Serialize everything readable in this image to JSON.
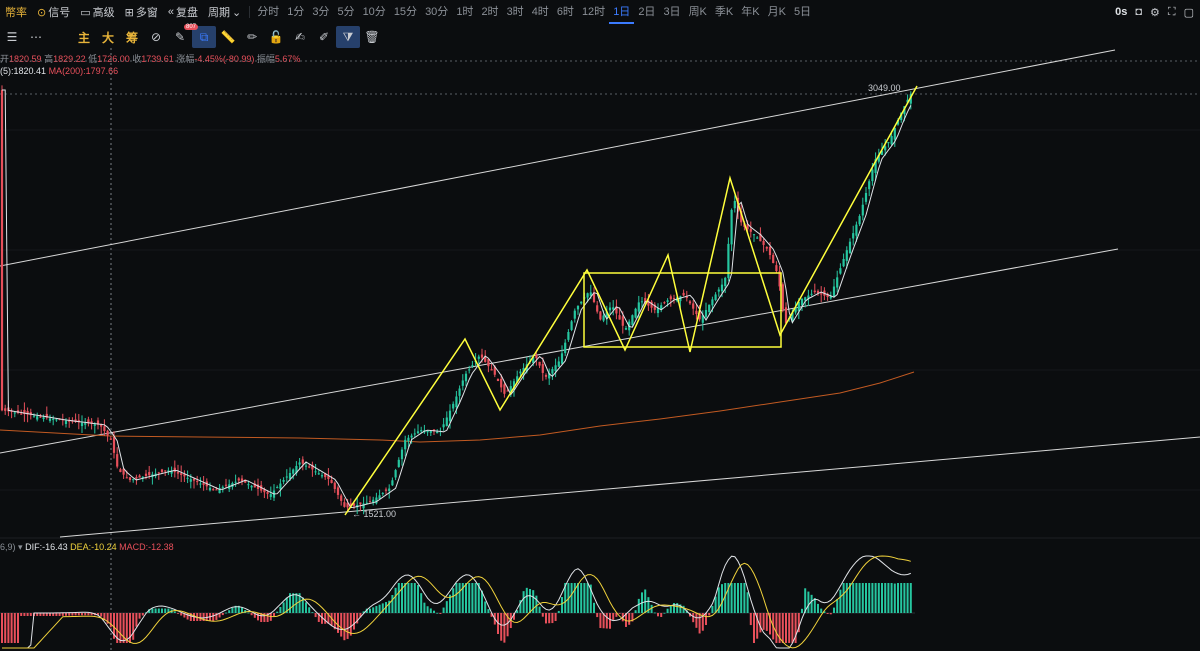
{
  "toolbar": {
    "items": [
      {
        "key": "rate",
        "label": "幣率"
      },
      {
        "key": "signal",
        "label": "信号"
      },
      {
        "key": "advanced",
        "label": "高级"
      },
      {
        "key": "multi",
        "label": "多窗"
      },
      {
        "key": "replay",
        "label": "复盘"
      },
      {
        "key": "period",
        "label": "周期"
      }
    ],
    "timeframes": [
      "分时",
      "1分",
      "3分",
      "5分",
      "10分",
      "15分",
      "30分",
      "1时",
      "2时",
      "3时",
      "4时",
      "6时",
      "12时",
      "1日",
      "2日",
      "3日",
      "周K",
      "季K",
      "年K",
      "月K",
      "5日"
    ],
    "active_timeframe": "1日",
    "right_label": "0s"
  },
  "toolbar2": {
    "indicator_labels": [
      "主",
      "大",
      "筹"
    ],
    "badge": "807"
  },
  "ohlc": {
    "open_label": "开",
    "open": "1820.59",
    "high_label": "高",
    "high": "1829.22",
    "low_label": "低",
    "low": "1726.00",
    "close_label": "收",
    "close": "1739.61",
    "change_label": "涨幅",
    "change": "-4.45%(-80.99)",
    "amp_label": "振幅",
    "amp": "5.67%"
  },
  "ma": {
    "ma5": "(5):1820.41",
    "ma200": "MA(200):1797.66"
  },
  "macd": {
    "params": "6,9)",
    "dif": "DIF:-16.43",
    "dea": "DEA:-10.24",
    "macd": "MACD:-12.38"
  },
  "annotations": {
    "high": "3049.00",
    "low": "← 1521.00"
  },
  "colors": {
    "up": "#26c6a0",
    "down": "#e8505b",
    "ma": "#f0d23c",
    "ma200": "#c25a22",
    "accent": "#3b7bff",
    "pattern": "#ffff3c"
  }
}
